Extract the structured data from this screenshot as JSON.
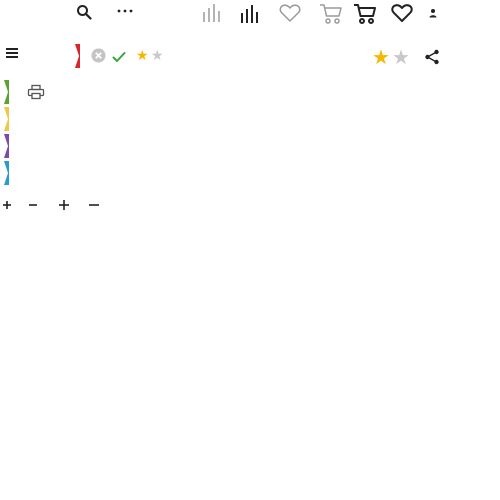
{
  "colors": {
    "icon_dark": "#222222",
    "icon_grey": "#9a9a9a",
    "star_gold": "#f5b800",
    "star_grey": "#c8c8c8",
    "check_green": "#3aa63a",
    "clear_grey": "#c4c4c4",
    "flag_red": "#d9252c",
    "flag_green": "#5aa531",
    "flag_yellow": "#f2c744",
    "flag_purple": "#7d4aa8",
    "flag_blue": "#2a9bd1"
  },
  "top_toolbar": {
    "icons": [
      "search-icon",
      "more-icon",
      "compare-icon-outline",
      "compare-icon-solid",
      "heart-icon-outline",
      "cart-icon-outline",
      "cart-icon-solid",
      "heart-icon",
      "user-icon"
    ]
  },
  "sub_toolbar": {
    "icons": [
      "menu-icon",
      "flag-icon",
      "clear-icon",
      "check-icon",
      "share-icon",
      "print-icon"
    ],
    "small_rating": {
      "value": 1,
      "max": 2
    },
    "large_rating": {
      "value": 1,
      "max": 2
    }
  },
  "flags": [
    "green",
    "yellow",
    "purple",
    "blue"
  ],
  "steppers": {
    "glyphs": [
      "+",
      "−",
      "+",
      "−"
    ]
  }
}
